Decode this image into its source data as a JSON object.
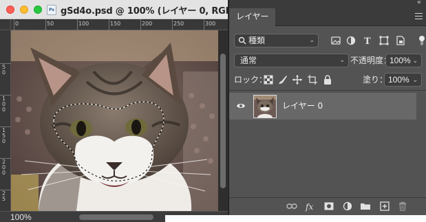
{
  "document": {
    "title": "gSd4o.psd @ 100% (レイヤー 0, RGB...",
    "app_icon": "Ps",
    "zoom": "100%",
    "ruler_top_labels": [
      "0",
      "50",
      "100",
      "150",
      "200",
      "250",
      "300"
    ],
    "ruler_left_labels": [
      "5 0",
      "1 0 0",
      "1 5 0",
      "2 0 0",
      "2 5"
    ]
  },
  "panel": {
    "tab_label": "レイヤー",
    "filter_kind": "種類",
    "blend_mode": "通常",
    "opacity_label": "不透明度：",
    "opacity_value": "100%",
    "lock_label": "ロック：",
    "fill_label": "塗り：",
    "fill_value": "100%",
    "layers": [
      {
        "name": "レイヤー 0",
        "visible": true
      }
    ]
  },
  "icons": {
    "filter": [
      "image-filter-icon",
      "adjustment-filter-icon",
      "type-filter-icon",
      "shape-filter-icon",
      "smart-object-filter-icon"
    ],
    "lock": [
      "lock-transparent-pixels-icon",
      "lock-image-pixels-icon",
      "lock-position-icon",
      "lock-artboard-icon",
      "lock-all-icon"
    ],
    "footer": [
      "link-layers-icon",
      "fx-icon",
      "add-mask-icon",
      "adjustment-layer-icon",
      "new-group-icon",
      "new-layer-icon",
      "trash-icon"
    ]
  }
}
